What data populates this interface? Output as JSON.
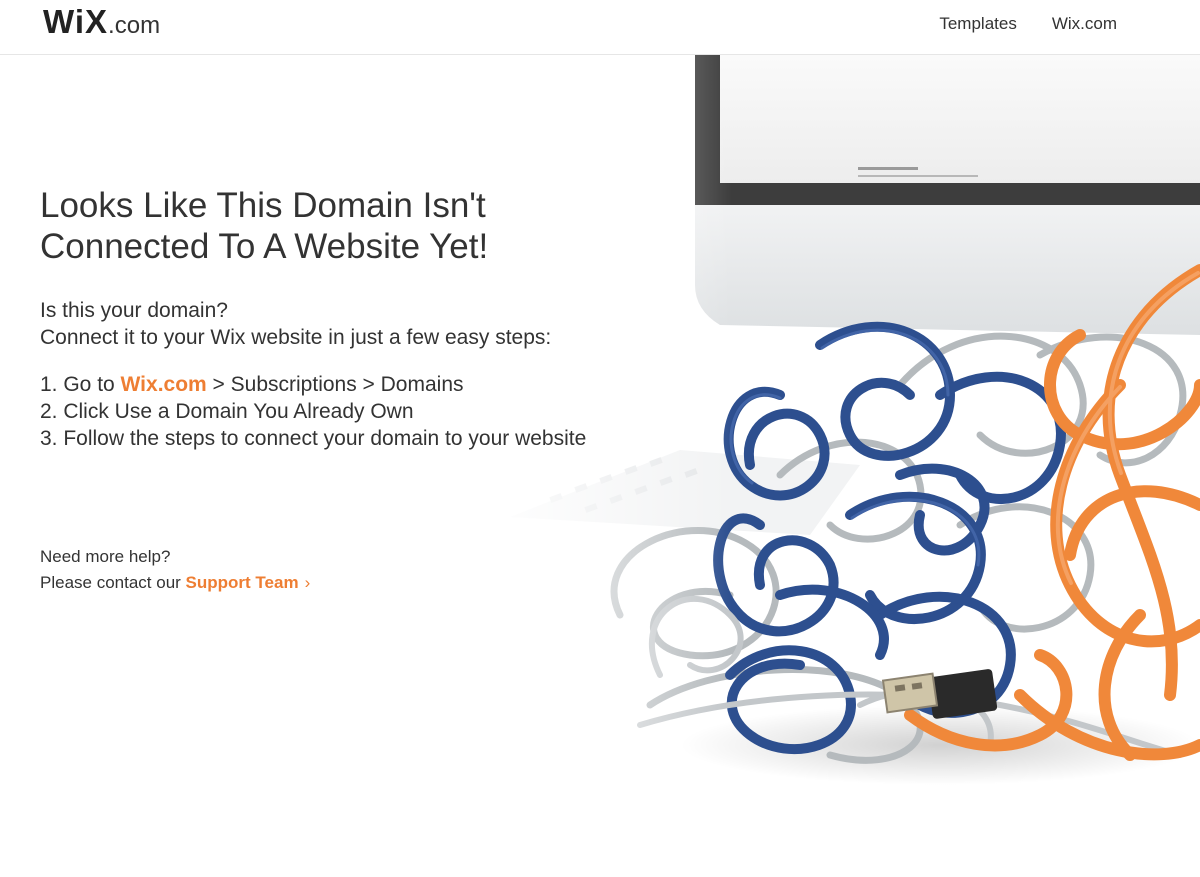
{
  "header": {
    "logo_main": "WiX",
    "logo_suffix": ".com",
    "nav": [
      "Templates",
      "Wix.com"
    ]
  },
  "main": {
    "headline_line1": "Looks Like This Domain Isn't",
    "headline_line2": "Connected To A Website Yet!",
    "intro_line1": "Is this your domain?",
    "intro_line2": "Connect it to your Wix website in just a few easy steps:",
    "steps": {
      "step1_prefix": "1. Go to ",
      "step1_link": "Wix.com",
      "step1_suffix": " > Subscriptions > Domains",
      "step2": "2. Click Use a Domain You Already Own",
      "step3": "3. Follow the steps to connect your domain to your website"
    },
    "help_line1": "Need more help?",
    "help_prefix": "Please contact our ",
    "support_link": "Support Team",
    "support_chevron": "›"
  },
  "colors": {
    "accent": "#ee7e33",
    "text": "#333333",
    "cable_blue": "#2d4f8f",
    "cable_orange": "#f0883a",
    "cable_grey": "#aeb4b8"
  },
  "icons": [
    "usb-plug-icon",
    "chevron-right-icon"
  ]
}
